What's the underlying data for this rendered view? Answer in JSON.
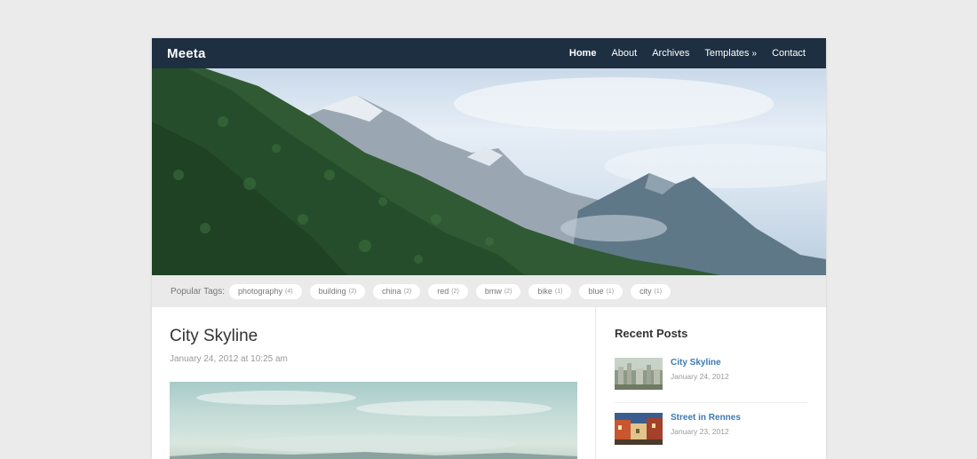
{
  "site": {
    "title": "Meeta"
  },
  "nav": {
    "items": [
      {
        "label": "Home"
      },
      {
        "label": "About"
      },
      {
        "label": "Archives"
      },
      {
        "label": "Templates"
      },
      {
        "label": "Contact"
      }
    ],
    "templates_arrow": "»"
  },
  "tags": {
    "label": "Popular Tags:",
    "items": [
      {
        "name": "photography",
        "count": "(4)"
      },
      {
        "name": "building",
        "count": "(2)"
      },
      {
        "name": "china",
        "count": "(2)"
      },
      {
        "name": "red",
        "count": "(2)"
      },
      {
        "name": "bmw",
        "count": "(2)"
      },
      {
        "name": "bike",
        "count": "(1)"
      },
      {
        "name": "blue",
        "count": "(1)"
      },
      {
        "name": "city",
        "count": "(1)"
      }
    ]
  },
  "post": {
    "title": "City Skyline",
    "date": "January 24, 2012 at 10:25 am"
  },
  "sidebar": {
    "title": "Recent Posts",
    "posts": [
      {
        "title": "City Skyline",
        "date": "January 24, 2012"
      },
      {
        "title": "Street in Rennes",
        "date": "January 23, 2012"
      }
    ]
  },
  "colors": {
    "topbar": "#1e2f42",
    "link": "#3c7ab4",
    "background": "#ebebeb"
  }
}
